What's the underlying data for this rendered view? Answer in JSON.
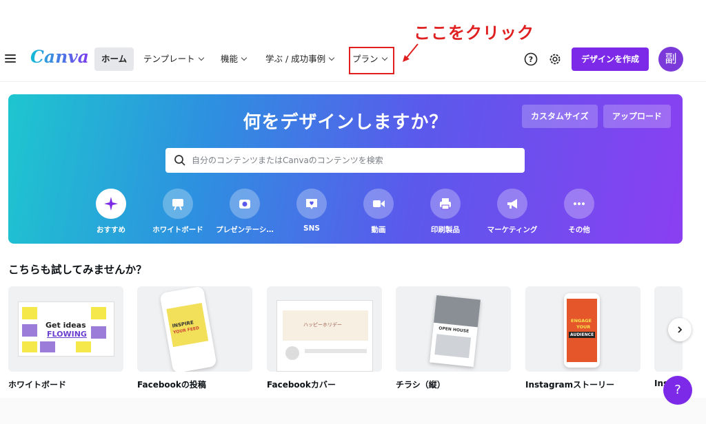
{
  "annotation": {
    "text": "ここをクリック",
    "color": "#e02020"
  },
  "header": {
    "logo": "Canva",
    "nav": [
      {
        "label": "ホーム",
        "active": true
      },
      {
        "label": "テンプレート"
      },
      {
        "label": "機能"
      },
      {
        "label": "学ぶ / 成功事例"
      },
      {
        "label": "プラン"
      }
    ],
    "help_icon": "question-circle-icon",
    "settings_icon": "gear-icon",
    "create_label": "デザインを作成",
    "avatar_initial": "副",
    "accent": "#7d2ae8"
  },
  "hero": {
    "title": "何をデザインしますか？",
    "custom_size_label": "カスタムサイズ",
    "upload_label": "アップロード",
    "search_placeholder": "自分のコンテンツまたはCanvaのコンテンツを検索",
    "categories": [
      {
        "label": "おすすめ",
        "icon": "sparkle-icon",
        "selected": true
      },
      {
        "label": "ホワイトボード",
        "icon": "whiteboard-icon"
      },
      {
        "label": "プレゼンテーシ…",
        "icon": "presentation-icon"
      },
      {
        "label": "SNS",
        "icon": "heart-chat-icon"
      },
      {
        "label": "動画",
        "icon": "video-icon"
      },
      {
        "label": "印刷製品",
        "icon": "printer-icon"
      },
      {
        "label": "マーケティング",
        "icon": "megaphone-icon"
      },
      {
        "label": "その他",
        "icon": "more-icon"
      }
    ]
  },
  "suggestions": {
    "title": "こちらも試してみませんか？",
    "cards": [
      {
        "label": "ホワイトボード",
        "thumb_text": [
          "Get ideas",
          "FLOWING"
        ]
      },
      {
        "label": "Facebookの投稿",
        "thumb_text": [
          "INSPIRE",
          "YOUR FEED"
        ]
      },
      {
        "label": "Facebookカバー",
        "thumb_text": [
          "ハッピーホリデー"
        ]
      },
      {
        "label": "チラシ（縦）",
        "thumb_text": [
          "OPEN HOUSE"
        ]
      },
      {
        "label": "Instagramストーリー",
        "thumb_text": [
          "ENGAGE",
          "YOUR",
          "AUDIENCE"
        ]
      },
      {
        "label": "Ins"
      }
    ],
    "help_label": "?"
  }
}
